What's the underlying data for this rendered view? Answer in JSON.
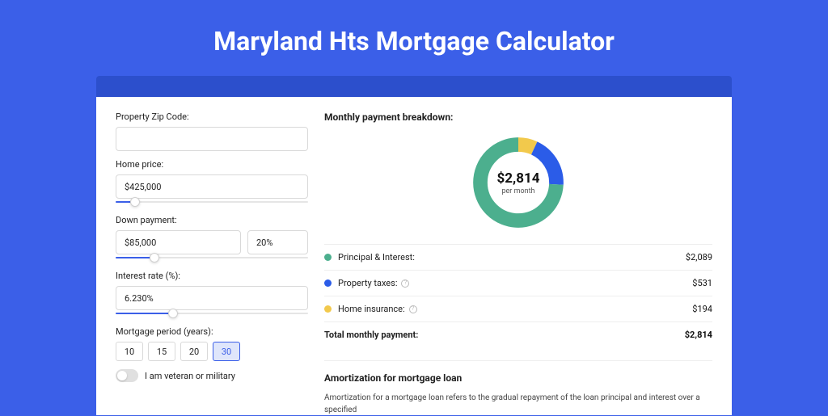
{
  "title": "Maryland Hts Mortgage Calculator",
  "form": {
    "zip_label": "Property Zip Code:",
    "zip_value": "",
    "home_price_label": "Home price:",
    "home_price_value": "$425,000",
    "home_price_slider_pct": 10,
    "down_payment_label": "Down payment:",
    "down_payment_amount": "$85,000",
    "down_payment_pct": "20%",
    "down_payment_slider_pct": 20,
    "interest_label": "Interest rate (%):",
    "interest_value": "6.230%",
    "interest_slider_pct": 30,
    "period_label": "Mortgage period (years):",
    "period_options": [
      "10",
      "15",
      "20",
      "30"
    ],
    "period_selected": "30",
    "veteran_label": "I am veteran or military",
    "veteran_on": false
  },
  "breakdown": {
    "title": "Monthly payment breakdown:",
    "center_amount": "$2,814",
    "center_sub": "per month",
    "items": [
      {
        "label": "Principal & Interest:",
        "value": "$2,089",
        "color": "#4CAF8E",
        "info": false,
        "num": 2089
      },
      {
        "label": "Property taxes:",
        "value": "$531",
        "color": "#2B5CE8",
        "info": true,
        "num": 531
      },
      {
        "label": "Home insurance:",
        "value": "$194",
        "color": "#F2C94C",
        "info": true,
        "num": 194
      }
    ],
    "total_label": "Total monthly payment:",
    "total_value": "$2,814"
  },
  "chart_data": {
    "type": "pie",
    "title": "Monthly payment breakdown",
    "categories": [
      "Principal & Interest",
      "Property taxes",
      "Home insurance"
    ],
    "values": [
      2089,
      531,
      194
    ],
    "colors": [
      "#4CAF8E",
      "#2B5CE8",
      "#F2C94C"
    ],
    "total": 2814
  },
  "amort": {
    "title": "Amortization for mortgage loan",
    "body": "Amortization for a mortgage loan refers to the gradual repayment of the loan principal and interest over a specified"
  }
}
